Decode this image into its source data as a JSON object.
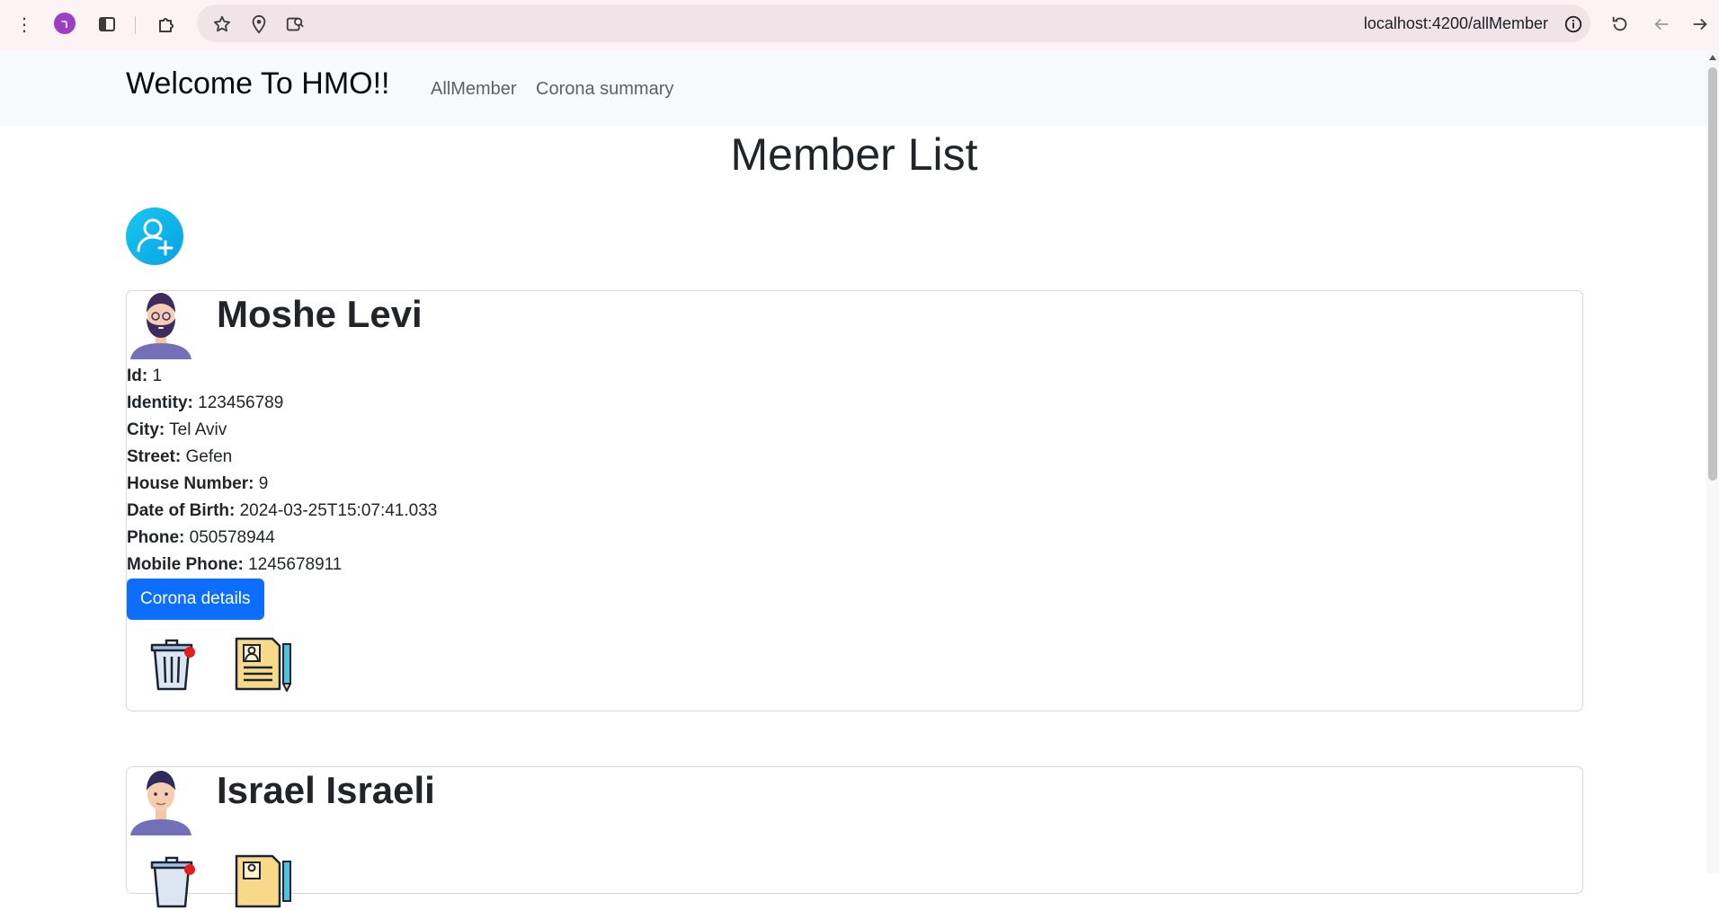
{
  "browser": {
    "profile_initial": "ר",
    "url": "localhost:4200/allMember"
  },
  "navbar": {
    "brand": "Welcome To HMO!!",
    "links": [
      "AllMember",
      "Corona summary"
    ]
  },
  "main": {
    "title": "Member List"
  },
  "members": [
    {
      "name": "Moshe Levi",
      "fields": [
        {
          "label": "Id:",
          "value": "1"
        },
        {
          "label": "Identity:",
          "value": "123456789"
        },
        {
          "label": "City:",
          "value": "Tel Aviv"
        },
        {
          "label": "Street:",
          "value": "Gefen"
        },
        {
          "label": "House Number:",
          "value": "9"
        },
        {
          "label": "Date of Birth:",
          "value": "2024-03-25T15:07:41.033"
        },
        {
          "label": "Phone:",
          "value": "050578944"
        },
        {
          "label": "Mobile Phone:",
          "value": "1245678911"
        }
      ],
      "corona_button": "Corona details"
    },
    {
      "name": "Israel Israeli"
    }
  ],
  "colors": {
    "primary_button": "#0d6efd",
    "add_icon": "#16c8ee",
    "navbar_bg": "#f8f9fa"
  }
}
